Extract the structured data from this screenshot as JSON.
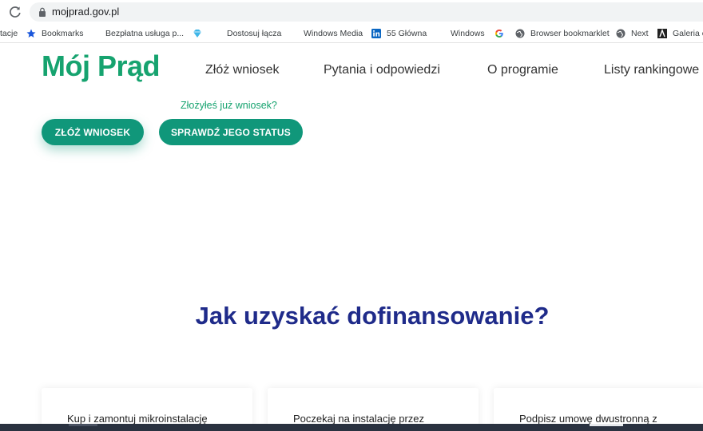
{
  "browser": {
    "url": "mojprad.gov.pl",
    "bookmarks": [
      {
        "label": "tacje",
        "icon": "none"
      },
      {
        "label": "Bookmarks",
        "icon": "star-icon"
      },
      {
        "label": "Bezpłatna usługa p...",
        "icon": "windows-logo-icon"
      },
      {
        "label": "",
        "icon": "gem-icon"
      },
      {
        "label": "Dostosuj łącza",
        "icon": "windows-logo-icon"
      },
      {
        "label": "Windows Media",
        "icon": "windows-logo-icon"
      },
      {
        "label": "55 Główna",
        "icon": "linkedin-icon"
      },
      {
        "label": "Windows",
        "icon": "windows-logo-icon"
      },
      {
        "label": "",
        "icon": "google-icon"
      },
      {
        "label": "Browser bookmarklet",
        "icon": "globe-icon"
      },
      {
        "label": "Next",
        "icon": "globe-icon"
      },
      {
        "label": "Galeria c",
        "icon": "gallery-icon"
      }
    ]
  },
  "site": {
    "logo": "Mój Prąd",
    "nav": [
      "Złóż wniosek",
      "Pytania i odpowiedzi",
      "O programie",
      "Listy rankingowe"
    ],
    "status_hint": "Złożyłeś już wniosek?",
    "apply_button": "ZŁÓŻ WNIOSEK",
    "status_button": "SPRAWDŹ JEGO STATUS",
    "section_title": "Jak uzyskać dofinansowanie?",
    "steps": [
      "Kup i zamontuj mikroinstalację",
      "Poczekaj na instalację przez",
      "Podpisz umowę dwustronną z"
    ]
  },
  "colors": {
    "brand_green": "#16a36f",
    "button_green": "#10977a",
    "title_blue": "#1f2b8a"
  }
}
